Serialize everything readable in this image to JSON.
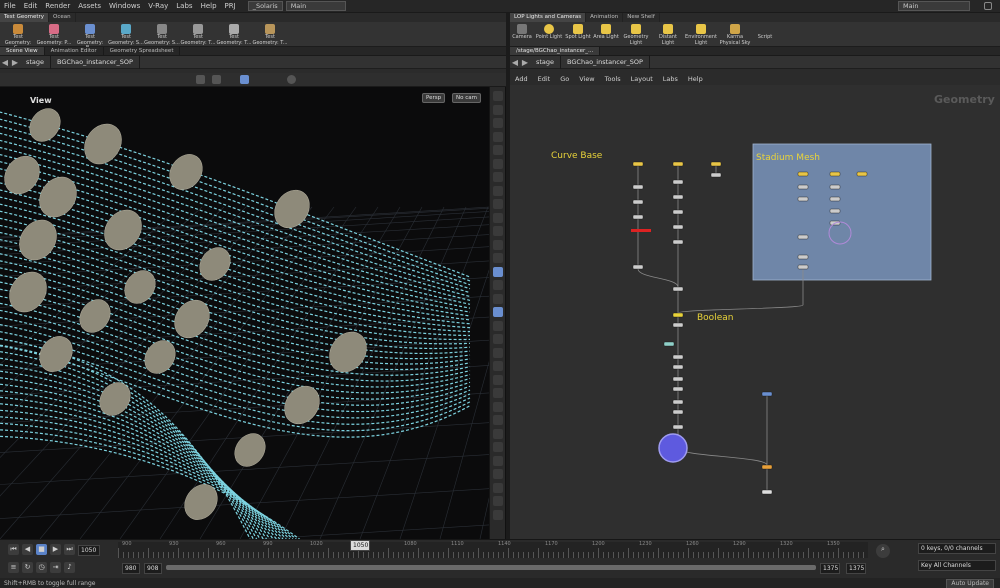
{
  "menubar": {
    "items": [
      "File",
      "Edit",
      "Render",
      "Assets",
      "Windows",
      "V-Ray",
      "Labs",
      "Help",
      "PRJ"
    ],
    "desktop": "_Solaris",
    "context": "Main",
    "right_context": "Main"
  },
  "left_shelf": {
    "tabs": [
      "Test Geometry",
      "Ocean"
    ],
    "tools": [
      "Test Geometry: C...",
      "Test Geometry: P...",
      "Test Geometry: B...",
      "Test Geometry: S...",
      "Test Geometry: S...",
      "Test Geometry: T...",
      "Test Geometry: T...",
      "Test Geometry: T..."
    ]
  },
  "right_shelf": {
    "tabs": [
      "LOP Lights and Cameras",
      "Animation",
      "New Shelf"
    ],
    "tools": [
      "Camera",
      "Point Light",
      "Spot Light",
      "Area Light",
      "Geometry Light",
      "Distant Light",
      "Environment Light",
      "Karma Physical Sky",
      "Script"
    ]
  },
  "left_panetabs": [
    "Scene View",
    "Animation Editor",
    "Geometry Spreadsheet"
  ],
  "right_panetabs": [
    "/stage/BGChao_instancer_..."
  ],
  "left_path": {
    "context": "stage",
    "node": "BGChao_instancer_SOP"
  },
  "right_path": {
    "context": "stage",
    "node": "BGChao_instancer_SOP"
  },
  "viewport": {
    "label": "View",
    "persp": "Persp",
    "cam": "No cam"
  },
  "network_menu": [
    "Add",
    "Edit",
    "Go",
    "View",
    "Tools",
    "Layout",
    "Labs",
    "Help"
  ],
  "network": {
    "context_label": "Geometry",
    "notes": {
      "curve_base": "Curve Base",
      "stadium_mesh": "Stadium Mesh",
      "boolean": "Boolean"
    }
  },
  "timeline": {
    "current_frame": "1050",
    "frame_marker": "1050",
    "range_start": "980",
    "range_start2": "908",
    "range_end": "1375",
    "range_end2": "1375",
    "ticks": [
      "900",
      "930",
      "960",
      "990",
      "1020",
      "1050",
      "1080",
      "1110",
      "1140",
      "1170",
      "1200",
      "1230",
      "1260",
      "1290",
      "1320",
      "1350"
    ],
    "keys_label": "0 keys, 0/0 channels",
    "key_all_label": "Key All Channels",
    "auto_update": "Auto Update",
    "status": "Shift+RMB to toggle full range"
  },
  "colors": {
    "accent": "#7dd3e0",
    "note_yellow": "#e8d33a",
    "mesh_box": "#6f86a8",
    "bg": "#2b2b2b"
  }
}
